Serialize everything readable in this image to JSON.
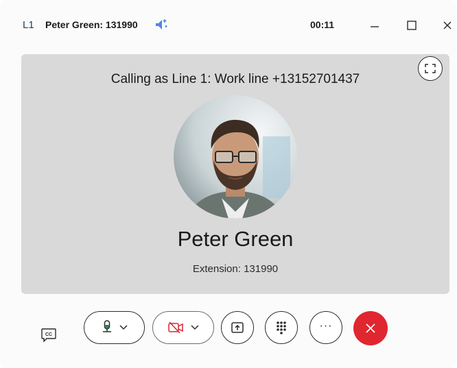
{
  "window": {
    "line_tag": "L1",
    "title": "Peter Green: 131990",
    "timer": "00:11",
    "controls": [
      "minimize",
      "maximize",
      "close"
    ]
  },
  "stage": {
    "calling_as": "Calling as Line 1: Work line +13152701437",
    "contact_name": "Peter Green",
    "extension": "Extension: 131990",
    "background_color": "#d9d9d9"
  },
  "toolbar": {
    "icons": [
      "closed-captions-icon",
      "microphone-icon",
      "chevron-down-icon",
      "video-off-icon",
      "chevron-down-icon",
      "share-screen-icon",
      "keypad-icon",
      "more-icon",
      "end-call-icon"
    ],
    "more_label": "···",
    "end_call_color": "#e0262f",
    "video_off_color": "#d9262f",
    "mic_active_color": "#1f8a4c"
  },
  "colors": {
    "noise_icon": "#4f86e8",
    "line_tag": "#1f3f5b"
  }
}
